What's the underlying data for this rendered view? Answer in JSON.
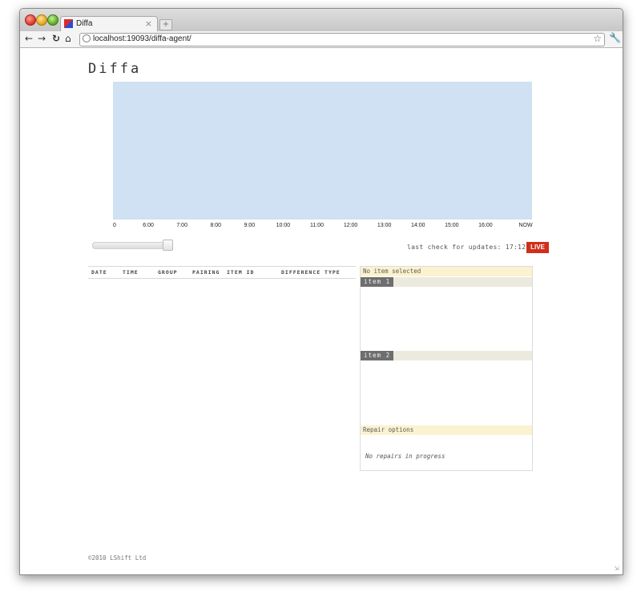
{
  "browser": {
    "tab_title": "Diffa",
    "tab_close": "×",
    "new_tab": "+",
    "url": "localhost:19093/diffa-agent/",
    "back_icon": "back-arrow-icon",
    "forward_icon": "forward-arrow-icon",
    "reload_icon": "reload-icon",
    "home_icon": "home-icon",
    "bookmark_icon": "star-icon",
    "menu_icon": "wrench-icon"
  },
  "page": {
    "title": "Diffa",
    "heatmap_color": "#cfe1f2",
    "time_axis": [
      "0",
      "6:00",
      "7:00",
      "8:00",
      "9:00",
      "10:00",
      "11:00",
      "12:00",
      "13:00",
      "14:00",
      "15:00",
      "16:00",
      "NOW"
    ],
    "zoom_slider_level": 1.0,
    "last_check": "last check for updates: 17:12:39s",
    "live_label": "LIVE",
    "live_color": "#d02e1c"
  },
  "table": {
    "columns": [
      "DATE",
      "TIME",
      "GROUP",
      "PAIRING",
      "ITEM ID",
      "DIFFERENCE TYPE"
    ]
  },
  "detail": {
    "header": "No item selected",
    "item1_label": "item 1",
    "item2_label": "item 2",
    "repair_header": "Repair options",
    "repair_status": "No repairs in progress"
  },
  "footer": {
    "copyright": "©2010 LShift Ltd"
  }
}
